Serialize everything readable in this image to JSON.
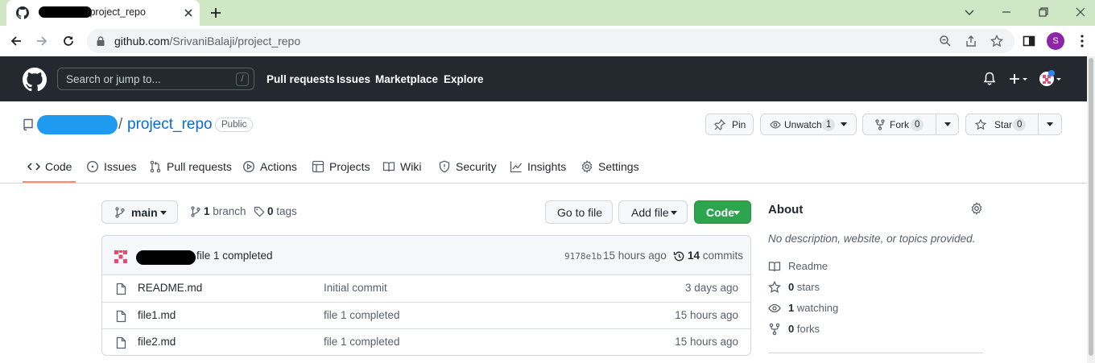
{
  "browser": {
    "tab_title": "/project_repo",
    "url_host": "github.com",
    "url_path": "/SrivaniBalaji/project_repo",
    "profile_initial": "S"
  },
  "gh_header": {
    "search_placeholder": "Search or jump to...",
    "search_shortcut": "/",
    "nav": [
      "Pull requests",
      "Issues",
      "Marketplace",
      "Explore"
    ]
  },
  "repo": {
    "separator": "/",
    "name": "project_repo",
    "visibility": "Public",
    "pin_label": "Pin",
    "unwatch_label": "Unwatch",
    "watch_count": "1",
    "fork_label": "Fork",
    "fork_count": "0",
    "star_label": "Star",
    "star_count": "0"
  },
  "tabs": [
    {
      "label": "Code",
      "icon": "code-icon",
      "active": true
    },
    {
      "label": "Issues",
      "icon": "issue-icon"
    },
    {
      "label": "Pull requests",
      "icon": "pull-request-icon"
    },
    {
      "label": "Actions",
      "icon": "play-icon"
    },
    {
      "label": "Projects",
      "icon": "table-icon"
    },
    {
      "label": "Wiki",
      "icon": "book-icon"
    },
    {
      "label": "Security",
      "icon": "shield-icon"
    },
    {
      "label": "Insights",
      "icon": "graph-icon"
    },
    {
      "label": "Settings",
      "icon": "gear-icon"
    }
  ],
  "toolbar": {
    "branch": "main",
    "branch_count": "1",
    "branch_label": "branch",
    "tag_count": "0",
    "tag_label": "tags",
    "go_to_file": "Go to file",
    "add_file": "Add file",
    "code": "Code"
  },
  "latest_commit": {
    "message": "file 1 completed",
    "sha": "9178e1b",
    "age": "15 hours ago",
    "commit_count": "14",
    "commit_label": "commits"
  },
  "files": [
    {
      "name": "README.md",
      "message": "Initial commit",
      "age": "3 days ago"
    },
    {
      "name": "file1.md",
      "message": "file 1 completed",
      "age": "15 hours ago"
    },
    {
      "name": "file2.md",
      "message": "file 1 completed",
      "age": "15 hours ago"
    }
  ],
  "about": {
    "title": "About",
    "description": "No description, website, or topics provided.",
    "readme": "Readme",
    "stars_count": "0",
    "stars_label": "stars",
    "watching_count": "1",
    "watching_label": "watching",
    "forks_count": "0",
    "forks_label": "forks"
  },
  "colors": {
    "header_bg": "#24292f",
    "link": "#0969da",
    "green_button": "#2da44e",
    "tab_underline": "#fd8c73",
    "chrome_tabbar": "#cfe7c4"
  }
}
